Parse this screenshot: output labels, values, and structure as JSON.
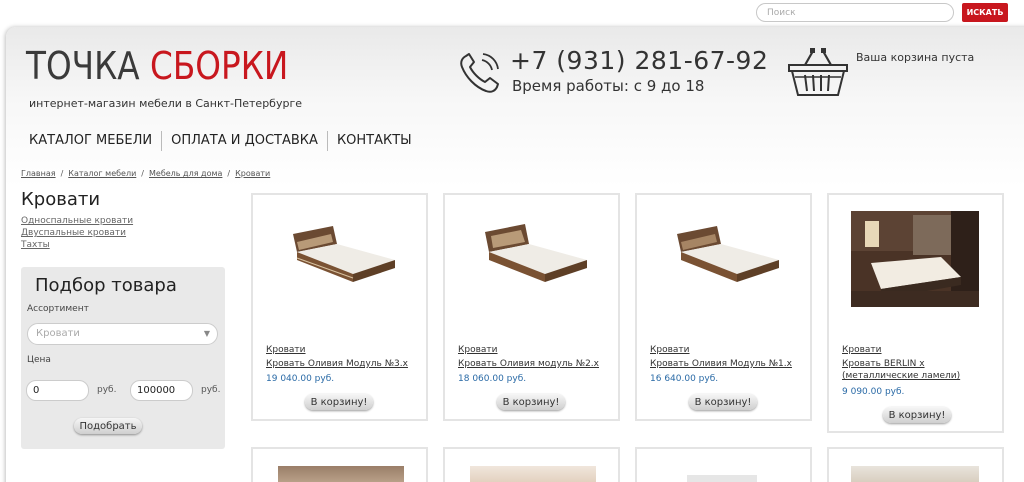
{
  "search": {
    "placeholder": "Поиск",
    "button_label": "искать"
  },
  "brand": {
    "name_part1": "ТОЧКА",
    "name_part2": "СБОРКИ",
    "tagline": "интернет-магазин мебели в Санкт-Петербурге",
    "accent": "#c8171e"
  },
  "contact": {
    "phone": "+7 (931) 281-67-92",
    "hours": "Время работы: с 9 до 18",
    "icon": "phone-icon"
  },
  "cart": {
    "status": "Ваша корзина пуста",
    "icon": "basket-icon"
  },
  "nav": {
    "items": [
      "Каталог мебели",
      "Оплата и доставка",
      "Контакты"
    ]
  },
  "breadcrumb": [
    "Главная",
    "Каталог мебели",
    "Мебель для дома",
    "Кровати"
  ],
  "category": {
    "title": "Кровати",
    "subcategories": [
      "Односпальные кровати",
      "Двуспальные кровати",
      "Тахты"
    ]
  },
  "filter": {
    "title": "Подбор товара",
    "assortment_label": "Ассортимент",
    "assortment_value": "Кровати",
    "price_label": "Цена",
    "price_from": "0",
    "price_to": "100000",
    "currency": "руб.",
    "submit_label": "Подобрать"
  },
  "products": [
    {
      "category": "Кровати",
      "name": "Кровать Оливия Модуль №3.x",
      "price": "19 040.00 руб.",
      "button": "В корзину!"
    },
    {
      "category": "Кровати",
      "name": "Кровать Оливия модуль №2.x",
      "price": "18 060.00 руб.",
      "button": "В корзину!"
    },
    {
      "category": "Кровати",
      "name": "Кровать Оливия Модуль №1.x",
      "price": "16 640.00 руб.",
      "button": "В корзину!"
    },
    {
      "category": "Кровати",
      "name": "Кровать BERLIN x (металлические ламели)",
      "price": "9 090.00 руб.",
      "button": "В корзину!"
    }
  ]
}
